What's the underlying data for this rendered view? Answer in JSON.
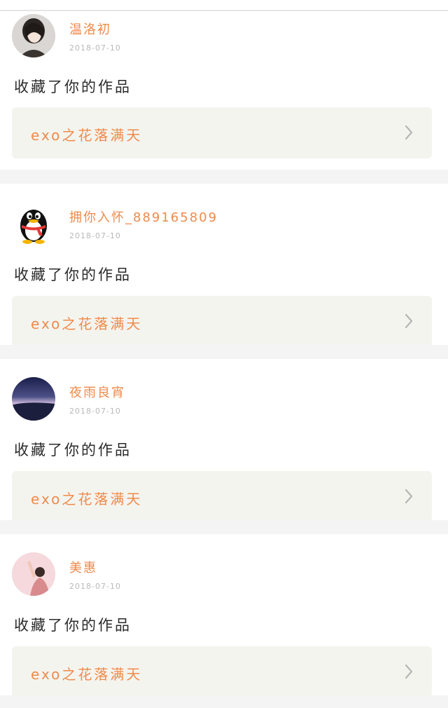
{
  "feed": [
    {
      "username": "温洛初",
      "date": "2018-07-10",
      "action": "收藏了你的作品",
      "work_title": "exo之花落满天",
      "avatar": "avatar-photo-woman"
    },
    {
      "username": "拥你入怀_889165809",
      "date": "2018-07-10",
      "action": "收藏了你的作品",
      "work_title": "exo之花落满天",
      "avatar": "penguin-icon"
    },
    {
      "username": "夜雨良宵",
      "date": "2018-07-10",
      "action": "收藏了你的作品",
      "work_title": "exo之花落满天",
      "avatar": "avatar-photo-night-sky"
    },
    {
      "username": "美惠",
      "date": "2018-07-10",
      "action": "收藏了你的作品",
      "work_title": "exo之花落满天",
      "avatar": "avatar-photo-pink"
    }
  ],
  "colors": {
    "accent": "#ef8a4a",
    "card_link_bg": "#f4f4ef",
    "page_bg": "#f4f4f4",
    "date": "#b8b8b8"
  },
  "icons": {
    "chevron": "chevron-right-icon"
  }
}
